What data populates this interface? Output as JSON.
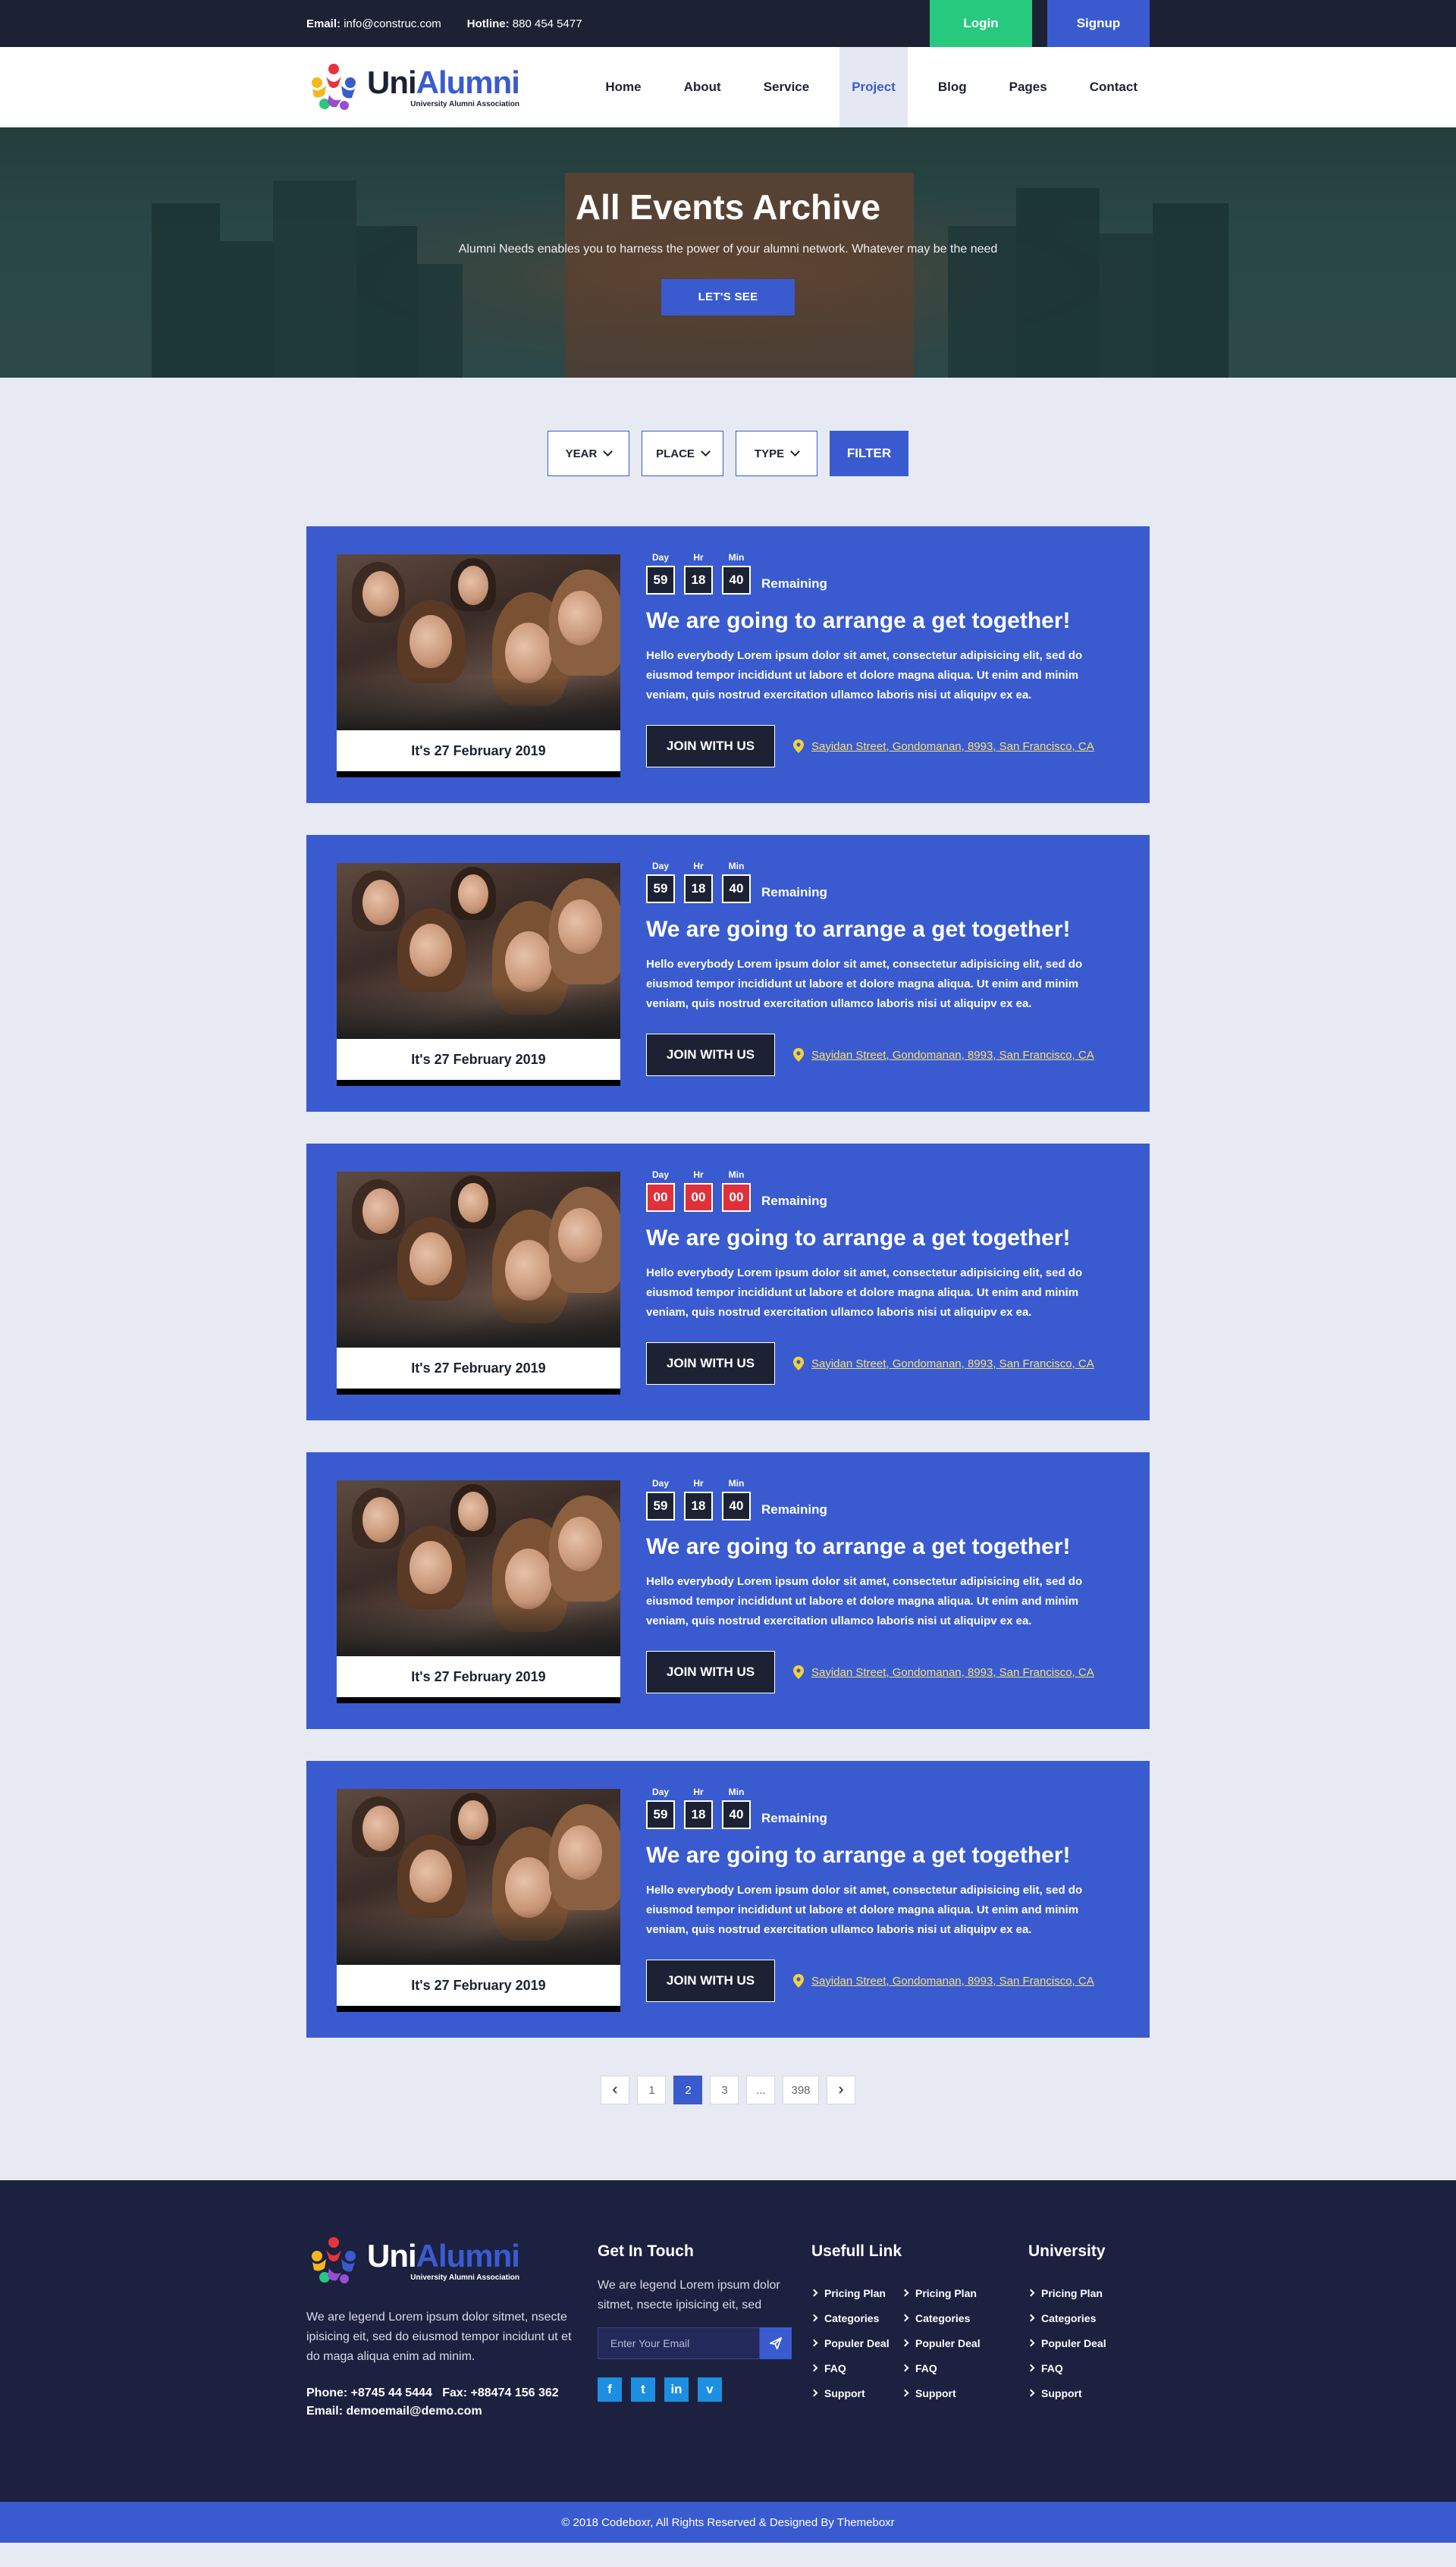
{
  "topbar": {
    "email_label": "Email:",
    "email": "info@construc.com",
    "hotline_label": "Hotline:",
    "hotline": "880 454 5477",
    "login": "Login",
    "signup": "Signup"
  },
  "brand": {
    "uni": "Uni",
    "alumni": "Alumni",
    "tagline": "University Alumni Association",
    "colors": {
      "primary": "#3a5bcf",
      "dark": "#1c2233",
      "green": "#27c97f",
      "red": "#e0313b"
    }
  },
  "nav": [
    {
      "label": "Home",
      "active": false
    },
    {
      "label": "About",
      "active": false
    },
    {
      "label": "Service",
      "active": false
    },
    {
      "label": "Project",
      "active": true
    },
    {
      "label": "Blog",
      "active": false
    },
    {
      "label": "Pages",
      "active": false
    },
    {
      "label": "Contact",
      "active": false
    }
  ],
  "hero": {
    "title": "All Events Archive",
    "subtitle": "Alumni Needs enables you to harness the power of your alumni network. Whatever may be the need",
    "cta": "LET'S SEE"
  },
  "filters": {
    "year": "YEAR",
    "place": "PLACE",
    "type": "TYPE",
    "button": "FILTER"
  },
  "countdown_labels": {
    "day": "Day",
    "hr": "Hr",
    "min": "Min",
    "remaining": "Remaining"
  },
  "events": [
    {
      "day": "59",
      "hr": "18",
      "min": "40",
      "expired": false,
      "date": "It's 27 February 2019",
      "title": "We are going to arrange a get together!",
      "description": "Hello everybody Lorem ipsum dolor sit amet, consectetur adipisicing elit, sed do eiusmod tempor incididunt ut labore et dolore magna aliqua. Ut enim and minim veniam, quis nostrud exercitation ullamco laboris nisi ut aliquipv ex ea.",
      "join": "JOIN WITH US",
      "location": "Sayidan Street, Gondomanan, 8993, San Francisco, CA"
    },
    {
      "day": "59",
      "hr": "18",
      "min": "40",
      "expired": false,
      "date": "It's 27 February 2019",
      "title": "We are going to arrange a get together!",
      "description": "Hello everybody Lorem ipsum dolor sit amet, consectetur adipisicing elit, sed do eiusmod tempor incididunt ut labore et dolore magna aliqua. Ut enim and minim veniam, quis nostrud exercitation ullamco laboris nisi ut aliquipv ex ea.",
      "join": "JOIN WITH US",
      "location": "Sayidan Street, Gondomanan, 8993, San Francisco, CA"
    },
    {
      "day": "00",
      "hr": "00",
      "min": "00",
      "expired": true,
      "date": "It's 27 February 2019",
      "title": "We are going to arrange a get together!",
      "description": "Hello everybody Lorem ipsum dolor sit amet, consectetur adipisicing elit, sed do eiusmod tempor incididunt ut labore et dolore magna aliqua. Ut enim and minim veniam, quis nostrud exercitation ullamco laboris nisi ut aliquipv ex ea.",
      "join": "JOIN WITH US",
      "location": "Sayidan Street, Gondomanan, 8993, San Francisco, CA"
    },
    {
      "day": "59",
      "hr": "18",
      "min": "40",
      "expired": false,
      "date": "It's 27 February 2019",
      "title": "We are going to arrange a get together!",
      "description": "Hello everybody Lorem ipsum dolor sit amet, consectetur adipisicing elit, sed do eiusmod tempor incididunt ut labore et dolore magna aliqua. Ut enim and minim veniam, quis nostrud exercitation ullamco laboris nisi ut aliquipv ex ea.",
      "join": "JOIN WITH US",
      "location": "Sayidan Street, Gondomanan, 8993, San Francisco, CA"
    },
    {
      "day": "59",
      "hr": "18",
      "min": "40",
      "expired": false,
      "date": "It's 27 February 2019",
      "title": "We are going to arrange a get together!",
      "description": "Hello everybody Lorem ipsum dolor sit amet, consectetur adipisicing elit, sed do eiusmod tempor incididunt ut labore et dolore magna aliqua. Ut enim and minim veniam, quis nostrud exercitation ullamco laboris nisi ut aliquipv ex ea.",
      "join": "JOIN WITH US",
      "location": "Sayidan Street, Gondomanan, 8993, San Francisco, CA"
    }
  ],
  "pagination": {
    "prev_icon": "chevron-left-icon",
    "next_icon": "chevron-right-icon",
    "pages": [
      "1",
      "2",
      "3",
      "...",
      "398"
    ],
    "current": "2"
  },
  "footer": {
    "about": "We are legend Lorem ipsum dolor sitmet, nsecte ipisicing eit, sed do eiusmod tempor incidunt ut et do maga aliqua enim ad minim.",
    "phone": "Phone: +8745 44 5444   Fax: +88474 156 362",
    "email": "Email: demoemail@demo.com",
    "get_in_touch": "Get In Touch",
    "touch_text": "We are legend Lorem ipsum dolor sitmet, nsecte ipisicing eit, sed",
    "email_placeholder": "Enter Your Email",
    "socials": [
      "f",
      "t",
      "in",
      "v"
    ],
    "useful_link": "Usefull Link",
    "useful_col1": [
      "Pricing Plan",
      "Categories",
      "Populer Deal",
      "FAQ",
      "Support"
    ],
    "useful_col2": [
      "Pricing Plan",
      "Categories",
      "Populer Deal",
      "FAQ",
      "Support"
    ],
    "university": "University",
    "university_links": [
      "Pricing Plan",
      "Categories",
      "Populer Deal",
      "FAQ",
      "Support"
    ],
    "copyright": "© 2018 Codeboxr, All Rights Reserved & Designed By Themeboxr"
  }
}
